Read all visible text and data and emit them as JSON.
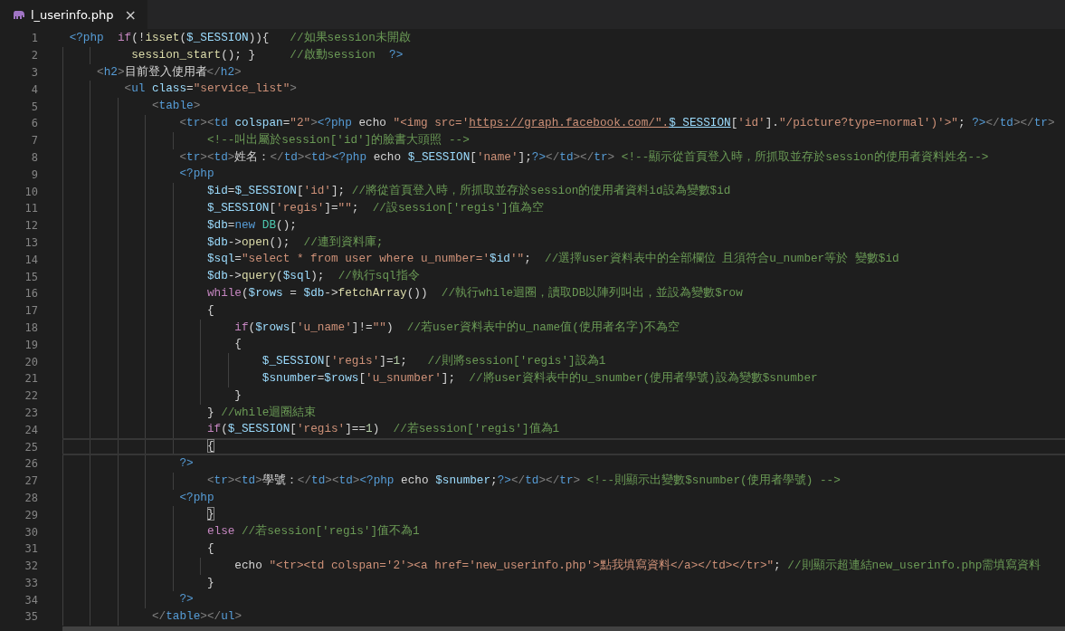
{
  "tab": {
    "filename": "l_userinfo.php",
    "close": "×",
    "selected": true
  },
  "lines": [
    {
      "number": "1",
      "current": false,
      "tokens": [
        {
          "kind": "keyword",
          "text": "<?php  "
        },
        {
          "kind": "control",
          "text": "if"
        },
        {
          "kind": "plain",
          "text": "(!"
        },
        {
          "kind": "function",
          "text": "isset"
        },
        {
          "kind": "plain",
          "text": "("
        },
        {
          "kind": "variable",
          "text": "$_SESSION"
        },
        {
          "kind": "plain",
          "text": ")){   "
        },
        {
          "kind": "comment",
          "text": "//如果session未開啟"
        }
      ]
    },
    {
      "number": "2",
      "current": false,
      "tokens": [
        {
          "kind": "function",
          "text": "         session_start"
        },
        {
          "kind": "plain",
          "text": "(); }     "
        },
        {
          "kind": "comment",
          "text": "//啟動session"
        },
        {
          "kind": "keyword",
          "text": "  ?>"
        }
      ]
    },
    {
      "number": "3",
      "current": false,
      "tokens": [
        {
          "kind": "punct",
          "text": "    <"
        },
        {
          "kind": "tag",
          "text": "h2"
        },
        {
          "kind": "punct",
          "text": ">"
        },
        {
          "kind": "plain",
          "text": "目前登入使用者"
        },
        {
          "kind": "punct",
          "text": "</"
        },
        {
          "kind": "tag",
          "text": "h2"
        },
        {
          "kind": "punct",
          "text": ">"
        }
      ]
    },
    {
      "number": "4",
      "current": false,
      "tokens": [
        {
          "kind": "punct",
          "text": "        <"
        },
        {
          "kind": "tag",
          "text": "ul"
        },
        {
          "kind": "attr",
          "text": " class"
        },
        {
          "kind": "plain",
          "text": "="
        },
        {
          "kind": "string",
          "text": "\"service_list\""
        },
        {
          "kind": "punct",
          "text": ">"
        }
      ]
    },
    {
      "number": "5",
      "current": false,
      "tokens": [
        {
          "kind": "punct",
          "text": "            <"
        },
        {
          "kind": "tag",
          "text": "table"
        },
        {
          "kind": "punct",
          "text": ">"
        }
      ]
    },
    {
      "number": "6",
      "current": false,
      "tokens": [
        {
          "kind": "punct",
          "text": "                <"
        },
        {
          "kind": "tag",
          "text": "tr"
        },
        {
          "kind": "punct",
          "text": "><"
        },
        {
          "kind": "tag",
          "text": "td"
        },
        {
          "kind": "attr",
          "text": " colspan"
        },
        {
          "kind": "plain",
          "text": "="
        },
        {
          "kind": "string",
          "text": "\"2\""
        },
        {
          "kind": "punct",
          "text": ">"
        },
        {
          "kind": "keyword",
          "text": "<?php"
        },
        {
          "kind": "plain",
          "text": " echo "
        },
        {
          "kind": "string",
          "text": "\"<img src='"
        },
        {
          "kind": "link",
          "text": "https://graph.facebook.com/\"."
        },
        {
          "kind": "varlink",
          "text": "$_SESSION"
        },
        {
          "kind": "plain",
          "text": "["
        },
        {
          "kind": "string",
          "text": "'id'"
        },
        {
          "kind": "plain",
          "text": "]."
        },
        {
          "kind": "string",
          "text": "\"/picture?type=normal')'>\""
        },
        {
          "kind": "plain",
          "text": "; "
        },
        {
          "kind": "keyword",
          "text": "?>"
        },
        {
          "kind": "punct",
          "text": "</"
        },
        {
          "kind": "tag",
          "text": "td"
        },
        {
          "kind": "punct",
          "text": "></"
        },
        {
          "kind": "tag",
          "text": "tr"
        },
        {
          "kind": "punct",
          "text": ">"
        }
      ]
    },
    {
      "number": "7",
      "current": false,
      "tokens": [
        {
          "kind": "comment",
          "text": "                    <!--叫出屬於session['id']的臉書大頭照 -->"
        }
      ]
    },
    {
      "number": "8",
      "current": false,
      "tokens": [
        {
          "kind": "punct",
          "text": "                <"
        },
        {
          "kind": "tag",
          "text": "tr"
        },
        {
          "kind": "punct",
          "text": "><"
        },
        {
          "kind": "tag",
          "text": "td"
        },
        {
          "kind": "punct",
          "text": ">"
        },
        {
          "kind": "plain",
          "text": "姓名："
        },
        {
          "kind": "punct",
          "text": "</"
        },
        {
          "kind": "tag",
          "text": "td"
        },
        {
          "kind": "punct",
          "text": "><"
        },
        {
          "kind": "tag",
          "text": "td"
        },
        {
          "kind": "punct",
          "text": ">"
        },
        {
          "kind": "keyword",
          "text": "<?php"
        },
        {
          "kind": "plain",
          "text": " echo "
        },
        {
          "kind": "variable",
          "text": "$_SESSION"
        },
        {
          "kind": "plain",
          "text": "["
        },
        {
          "kind": "string",
          "text": "'name'"
        },
        {
          "kind": "plain",
          "text": "];"
        },
        {
          "kind": "keyword",
          "text": "?>"
        },
        {
          "kind": "punct",
          "text": "</"
        },
        {
          "kind": "tag",
          "text": "td"
        },
        {
          "kind": "punct",
          "text": "></"
        },
        {
          "kind": "tag",
          "text": "tr"
        },
        {
          "kind": "punct",
          "text": "> "
        },
        {
          "kind": "comment",
          "text": "<!--顯示從首頁登入時，所抓取並存於session的使用者資料姓名-->"
        }
      ]
    },
    {
      "number": "9",
      "current": false,
      "tokens": [
        {
          "kind": "keyword",
          "text": "                <?php"
        }
      ]
    },
    {
      "number": "10",
      "current": false,
      "tokens": [
        {
          "kind": "variable",
          "text": "                    $id"
        },
        {
          "kind": "plain",
          "text": "="
        },
        {
          "kind": "variable",
          "text": "$_SESSION"
        },
        {
          "kind": "plain",
          "text": "["
        },
        {
          "kind": "string",
          "text": "'id'"
        },
        {
          "kind": "plain",
          "text": "]; "
        },
        {
          "kind": "comment",
          "text": "//將從首頁登入時，所抓取並存於session的使用者資料id設為變數$id"
        }
      ]
    },
    {
      "number": "11",
      "current": false,
      "tokens": [
        {
          "kind": "variable",
          "text": "                    $_SESSION"
        },
        {
          "kind": "plain",
          "text": "["
        },
        {
          "kind": "string",
          "text": "'regis'"
        },
        {
          "kind": "plain",
          "text": "]="
        },
        {
          "kind": "string",
          "text": "\"\""
        },
        {
          "kind": "plain",
          "text": ";  "
        },
        {
          "kind": "comment",
          "text": "//設session['regis']值為空"
        }
      ]
    },
    {
      "number": "12",
      "current": false,
      "tokens": [
        {
          "kind": "variable",
          "text": "                    $db"
        },
        {
          "kind": "plain",
          "text": "="
        },
        {
          "kind": "keyword",
          "text": "new "
        },
        {
          "kind": "class",
          "text": "DB"
        },
        {
          "kind": "plain",
          "text": "();"
        }
      ]
    },
    {
      "number": "13",
      "current": false,
      "tokens": [
        {
          "kind": "variable",
          "text": "                    $db"
        },
        {
          "kind": "plain",
          "text": "->"
        },
        {
          "kind": "function",
          "text": "open"
        },
        {
          "kind": "plain",
          "text": "();  "
        },
        {
          "kind": "comment",
          "text": "//連到資料庫;"
        }
      ]
    },
    {
      "number": "14",
      "current": false,
      "tokens": [
        {
          "kind": "variable",
          "text": "                    $sql"
        },
        {
          "kind": "plain",
          "text": "="
        },
        {
          "kind": "string",
          "text": "\"select * from user where u_number='"
        },
        {
          "kind": "variable",
          "text": "$id"
        },
        {
          "kind": "string",
          "text": "'\""
        },
        {
          "kind": "plain",
          "text": ";  "
        },
        {
          "kind": "comment",
          "text": "//選擇user資料表中的全部欄位 且須符合u_number等於 變數$id"
        }
      ]
    },
    {
      "number": "15",
      "current": false,
      "tokens": [
        {
          "kind": "variable",
          "text": "                    $db"
        },
        {
          "kind": "plain",
          "text": "->"
        },
        {
          "kind": "function",
          "text": "query"
        },
        {
          "kind": "plain",
          "text": "("
        },
        {
          "kind": "variable",
          "text": "$sql"
        },
        {
          "kind": "plain",
          "text": ");  "
        },
        {
          "kind": "comment",
          "text": "//執行sql指令"
        }
      ]
    },
    {
      "number": "16",
      "current": false,
      "tokens": [
        {
          "kind": "control",
          "text": "                    while"
        },
        {
          "kind": "plain",
          "text": "("
        },
        {
          "kind": "variable",
          "text": "$rows"
        },
        {
          "kind": "plain",
          "text": " = "
        },
        {
          "kind": "variable",
          "text": "$db"
        },
        {
          "kind": "plain",
          "text": "->"
        },
        {
          "kind": "function",
          "text": "fetchArray"
        },
        {
          "kind": "plain",
          "text": "())  "
        },
        {
          "kind": "comment",
          "text": "//執行while迴圈，讀取DB以陣列叫出，並設為變數$row"
        }
      ]
    },
    {
      "number": "17",
      "current": false,
      "tokens": [
        {
          "kind": "plain",
          "text": "                    {"
        }
      ]
    },
    {
      "number": "18",
      "current": false,
      "tokens": [
        {
          "kind": "control",
          "text": "                        if"
        },
        {
          "kind": "plain",
          "text": "("
        },
        {
          "kind": "variable",
          "text": "$rows"
        },
        {
          "kind": "plain",
          "text": "["
        },
        {
          "kind": "string",
          "text": "'u_name'"
        },
        {
          "kind": "plain",
          "text": "]!="
        },
        {
          "kind": "string",
          "text": "\"\""
        },
        {
          "kind": "plain",
          "text": ")  "
        },
        {
          "kind": "comment",
          "text": "//若user資料表中的u_name值(使用者名字)不為空"
        }
      ]
    },
    {
      "number": "19",
      "current": false,
      "tokens": [
        {
          "kind": "plain",
          "text": "                        {"
        }
      ]
    },
    {
      "number": "20",
      "current": false,
      "tokens": [
        {
          "kind": "variable",
          "text": "                            $_SESSION"
        },
        {
          "kind": "plain",
          "text": "["
        },
        {
          "kind": "string",
          "text": "'regis'"
        },
        {
          "kind": "plain",
          "text": "]="
        },
        {
          "kind": "number",
          "text": "1"
        },
        {
          "kind": "plain",
          "text": ";   "
        },
        {
          "kind": "comment",
          "text": "//則將session['regis']設為1"
        }
      ]
    },
    {
      "number": "21",
      "current": false,
      "tokens": [
        {
          "kind": "variable",
          "text": "                            $snumber"
        },
        {
          "kind": "plain",
          "text": "="
        },
        {
          "kind": "variable",
          "text": "$rows"
        },
        {
          "kind": "plain",
          "text": "["
        },
        {
          "kind": "string",
          "text": "'u_snumber'"
        },
        {
          "kind": "plain",
          "text": "];  "
        },
        {
          "kind": "comment",
          "text": "//將user資料表中的u_snumber(使用者學號)設為變數$snumber"
        }
      ]
    },
    {
      "number": "22",
      "current": false,
      "tokens": [
        {
          "kind": "plain",
          "text": "                        }"
        }
      ]
    },
    {
      "number": "23",
      "current": false,
      "tokens": [
        {
          "kind": "plain",
          "text": "                    } "
        },
        {
          "kind": "comment",
          "text": "//while迴圈結束"
        }
      ]
    },
    {
      "number": "24",
      "current": false,
      "tokens": [
        {
          "kind": "control",
          "text": "                    if"
        },
        {
          "kind": "plain",
          "text": "("
        },
        {
          "kind": "variable",
          "text": "$_SESSION"
        },
        {
          "kind": "plain",
          "text": "["
        },
        {
          "kind": "string",
          "text": "'regis'"
        },
        {
          "kind": "plain",
          "text": "]=="
        },
        {
          "kind": "number",
          "text": "1"
        },
        {
          "kind": "plain",
          "text": ")  "
        },
        {
          "kind": "comment",
          "text": "//若session['regis']值為1"
        }
      ]
    },
    {
      "number": "25",
      "current": true,
      "tokens": [
        {
          "kind": "match",
          "text": "                    {"
        }
      ]
    },
    {
      "number": "26",
      "current": false,
      "tokens": [
        {
          "kind": "keyword",
          "text": "                ?>"
        }
      ]
    },
    {
      "number": "27",
      "current": false,
      "tokens": [
        {
          "kind": "punct",
          "text": "                    <"
        },
        {
          "kind": "tag",
          "text": "tr"
        },
        {
          "kind": "punct",
          "text": "><"
        },
        {
          "kind": "tag",
          "text": "td"
        },
        {
          "kind": "punct",
          "text": ">"
        },
        {
          "kind": "plain",
          "text": "學號："
        },
        {
          "kind": "punct",
          "text": "</"
        },
        {
          "kind": "tag",
          "text": "td"
        },
        {
          "kind": "punct",
          "text": "><"
        },
        {
          "kind": "tag",
          "text": "td"
        },
        {
          "kind": "punct",
          "text": ">"
        },
        {
          "kind": "keyword",
          "text": "<?php"
        },
        {
          "kind": "plain",
          "text": " echo "
        },
        {
          "kind": "variable",
          "text": "$snumber"
        },
        {
          "kind": "plain",
          "text": ";"
        },
        {
          "kind": "keyword",
          "text": "?>"
        },
        {
          "kind": "punct",
          "text": "</"
        },
        {
          "kind": "tag",
          "text": "td"
        },
        {
          "kind": "punct",
          "text": "></"
        },
        {
          "kind": "tag",
          "text": "tr"
        },
        {
          "kind": "punct",
          "text": "> "
        },
        {
          "kind": "comment",
          "text": "<!--則顯示出變數$snumber(使用者學號) -->"
        }
      ]
    },
    {
      "number": "28",
      "current": false,
      "tokens": [
        {
          "kind": "keyword",
          "text": "                <?php"
        }
      ]
    },
    {
      "number": "29",
      "current": false,
      "tokens": [
        {
          "kind": "match",
          "text": "                    }"
        }
      ]
    },
    {
      "number": "30",
      "current": false,
      "tokens": [
        {
          "kind": "control",
          "text": "                    else "
        },
        {
          "kind": "comment",
          "text": "//若session['regis']值不為1"
        }
      ]
    },
    {
      "number": "31",
      "current": false,
      "tokens": [
        {
          "kind": "plain",
          "text": "                    {"
        }
      ]
    },
    {
      "number": "32",
      "current": false,
      "tokens": [
        {
          "kind": "plain",
          "text": "                        echo "
        },
        {
          "kind": "string",
          "text": "\"<tr><td colspan='2'><a href='new_userinfo.php'>點我填寫資料</a></td></tr>\""
        },
        {
          "kind": "plain",
          "text": "; "
        },
        {
          "kind": "comment",
          "text": "//則顯示超連結new_userinfo.php需填寫資料"
        }
      ]
    },
    {
      "number": "33",
      "current": false,
      "tokens": [
        {
          "kind": "plain",
          "text": "                    }"
        }
      ]
    },
    {
      "number": "34",
      "current": false,
      "tokens": [
        {
          "kind": "keyword",
          "text": "                ?>"
        }
      ]
    },
    {
      "number": "35",
      "current": false,
      "tokens": [
        {
          "kind": "punct",
          "text": "            </"
        },
        {
          "kind": "tag",
          "text": "table"
        },
        {
          "kind": "punct",
          "text": "></"
        },
        {
          "kind": "tag",
          "text": "ul"
        },
        {
          "kind": "punct",
          "text": ">"
        }
      ]
    }
  ]
}
